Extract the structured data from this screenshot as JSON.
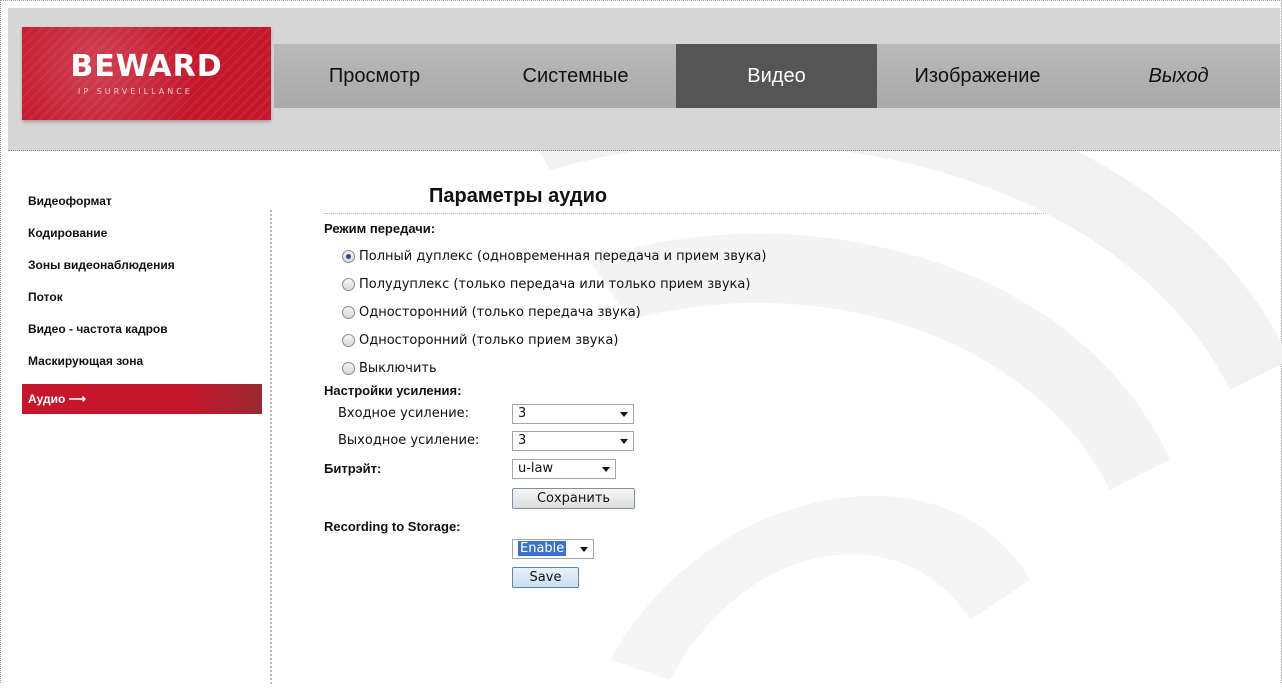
{
  "brand": {
    "logo_text": "BEWARD",
    "logo_sub": "IP SURVEILLANCE",
    "accent": "#c4172c"
  },
  "nav": {
    "items": [
      {
        "label": "Просмотр"
      },
      {
        "label": "Системные"
      },
      {
        "label": "Видео",
        "active": true
      },
      {
        "label": "Изображение"
      },
      {
        "label": "Выход"
      }
    ]
  },
  "sidebar": {
    "items": [
      {
        "label": "Видеоформат"
      },
      {
        "label": "Кодирование"
      },
      {
        "label": "Зоны видеонаблюдения"
      },
      {
        "label": "Поток"
      },
      {
        "label": "Видео - частота кадров"
      },
      {
        "label": "Маскирующая зона"
      },
      {
        "label": "Аудио ⟶",
        "active": true
      }
    ]
  },
  "main": {
    "title": "Параметры аудио",
    "mode_label": "Режим передачи:",
    "modes": [
      {
        "label": "Полный дуплекс (одновременная передача и прием звука)",
        "checked": true
      },
      {
        "label": "Полудуплекс (только передача или только прием звука)",
        "checked": false
      },
      {
        "label": "Односторонний (только передача звука)",
        "checked": false
      },
      {
        "label": "Односторонний (только прием звука)",
        "checked": false
      },
      {
        "label": "Выключить",
        "checked": false
      }
    ],
    "gain_label": "Настройки усиления:",
    "input_gain_label": "Входное усиление:",
    "input_gain_value": "3",
    "output_gain_label": "Выходное усиление:",
    "output_gain_value": "3",
    "bitrate_label": "Битрэйт:",
    "bitrate_value": "u-law",
    "save_ru_label": "Сохранить",
    "recording_label": "Recording to Storage:",
    "recording_value": "Enable",
    "save_label": "Save"
  }
}
